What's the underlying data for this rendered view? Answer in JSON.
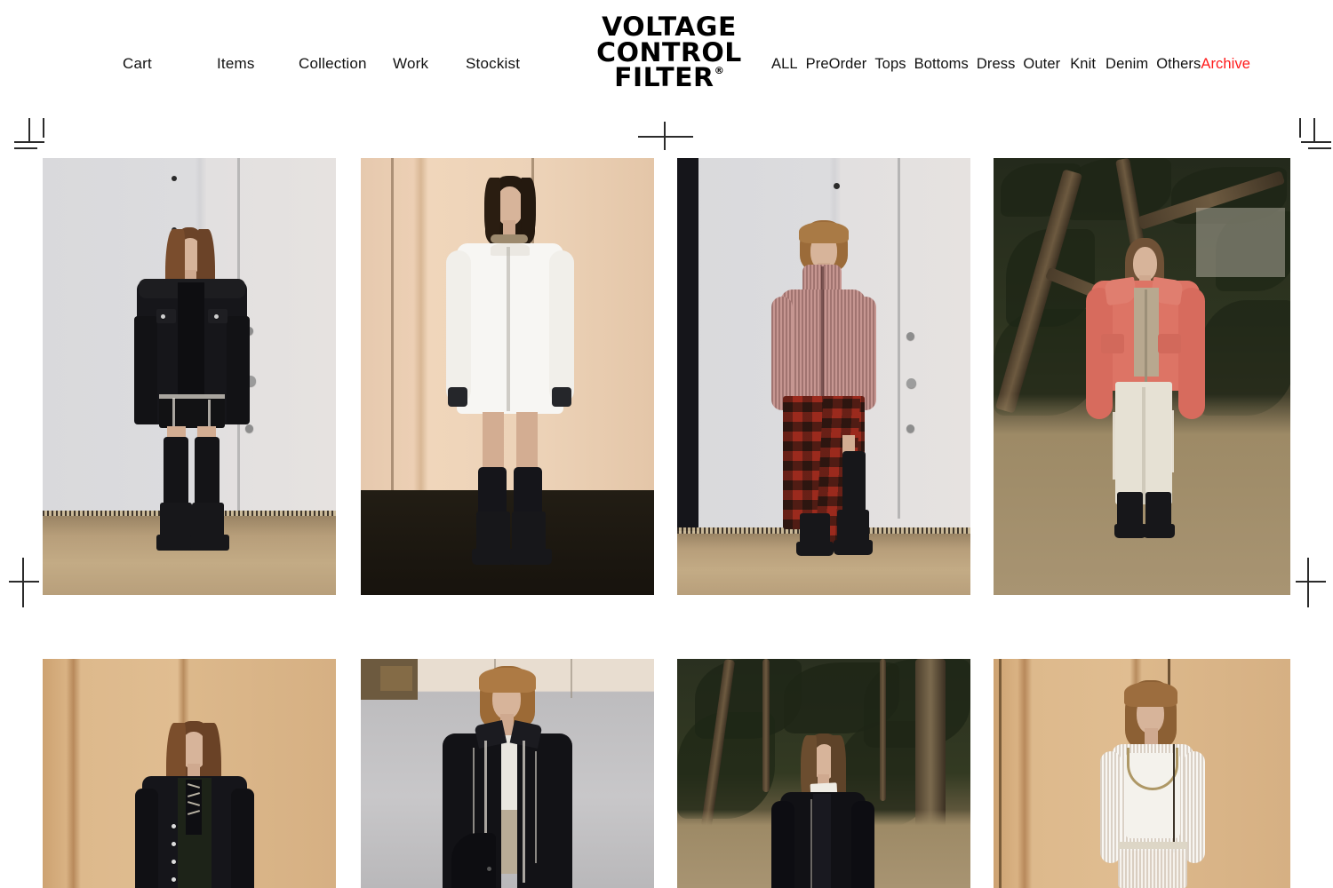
{
  "site": {
    "background_color": "#ffffff",
    "accent_color": "#ff1a1a",
    "text_color": "#111111"
  },
  "logo": {
    "line1": "VOLTAGE",
    "line2": "CONTROL",
    "line3": "FILTER",
    "trademark": "®",
    "full_name": "VOLTAGE CONTROL FILTER®"
  },
  "nav_left": {
    "items": [
      {
        "label": "Cart"
      },
      {
        "label": "Items"
      },
      {
        "label": "Collection"
      },
      {
        "label": "Work"
      },
      {
        "label": "Stockist"
      }
    ]
  },
  "nav_right": {
    "items": [
      {
        "label": "ALL",
        "active": false
      },
      {
        "label": "PreOrder",
        "active": false
      },
      {
        "label": "Tops",
        "active": false
      },
      {
        "label": "Bottoms",
        "active": false
      },
      {
        "label": "Dress",
        "active": false
      },
      {
        "label": "Outer",
        "active": false
      },
      {
        "label": "Knit",
        "active": false
      },
      {
        "label": "Denim",
        "active": false
      },
      {
        "label": "Others",
        "active": false
      },
      {
        "label": "Archive",
        "active": true
      }
    ]
  },
  "gallery": {
    "row1": [
      {
        "alt": "Model in black distressed denim jacket with black shorts, tall black leg warmers and chunky boots against a light gray wall"
      },
      {
        "alt": "Model in oversized white long sleeve tunic with black leg warmers and boots against pale wood panelling"
      },
      {
        "alt": "Model in dusty rose ribbed knit zip high neck sweater with red and black plaid long skirt and black boots"
      },
      {
        "alt": "Model in coral puffer jacket with white trousers and black boots outdoors among trees"
      }
    ],
    "row2": [
      {
        "alt": "Model with long auburn hair in oversized black coat with lace up front against beige wood panelling"
      },
      {
        "alt": "Model in black frayed coat over white top against gray wall with beige upper band"
      },
      {
        "alt": "Model in black coat with white collar shirt outdoors in a bamboo forest"
      },
      {
        "alt": "Model in sheer white ribbed knit top with necklace and cream skirt against warm wood panelling"
      }
    ]
  },
  "registration_marks": {
    "top_left": "corner-mark",
    "top_center": "cross-mark",
    "top_right": "corner-mark",
    "mid_left": "cross-mark",
    "mid_right": "cross-mark"
  }
}
